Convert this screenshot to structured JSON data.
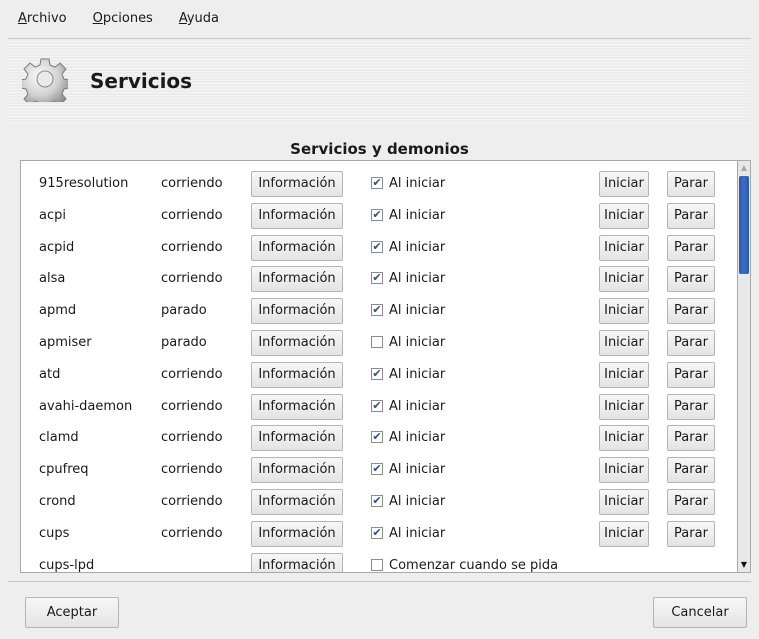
{
  "menu": {
    "archivo": "Archivo",
    "opciones": "Opciones",
    "ayuda": "Ayuda"
  },
  "header": {
    "title": "Servicios",
    "icon": "gear-icon"
  },
  "section_title": "Servicios y demonios",
  "labels": {
    "info": "Información",
    "start": "Iniciar",
    "stop": "Parar"
  },
  "services": [
    {
      "name": "915resolution",
      "state": "corriendo",
      "checked": true,
      "on_boot": "Al iniciar"
    },
    {
      "name": "acpi",
      "state": "corriendo",
      "checked": true,
      "on_boot": "Al iniciar"
    },
    {
      "name": "acpid",
      "state": "corriendo",
      "checked": true,
      "on_boot": "Al iniciar"
    },
    {
      "name": "alsa",
      "state": "corriendo",
      "checked": true,
      "on_boot": "Al iniciar"
    },
    {
      "name": "apmd",
      "state": "parado",
      "checked": true,
      "on_boot": "Al iniciar"
    },
    {
      "name": "apmiser",
      "state": "parado",
      "checked": false,
      "on_boot": "Al iniciar"
    },
    {
      "name": "atd",
      "state": "corriendo",
      "checked": true,
      "on_boot": "Al iniciar"
    },
    {
      "name": "avahi-daemon",
      "state": "corriendo",
      "checked": true,
      "on_boot": "Al iniciar"
    },
    {
      "name": "clamd",
      "state": "corriendo",
      "checked": true,
      "on_boot": "Al iniciar"
    },
    {
      "name": "cpufreq",
      "state": "corriendo",
      "checked": true,
      "on_boot": "Al iniciar"
    },
    {
      "name": "crond",
      "state": "corriendo",
      "checked": true,
      "on_boot": "Al iniciar"
    },
    {
      "name": "cups",
      "state": "corriendo",
      "checked": true,
      "on_boot": "Al iniciar"
    },
    {
      "name": "cups-lpd",
      "state": "",
      "checked": false,
      "on_boot": "Comenzar cuando se pida"
    }
  ],
  "buttons": {
    "accept": "Aceptar",
    "cancel": "Cancelar"
  },
  "colors": {
    "scroll_thumb": "#2c57a8",
    "check": "#2b4f8a"
  }
}
